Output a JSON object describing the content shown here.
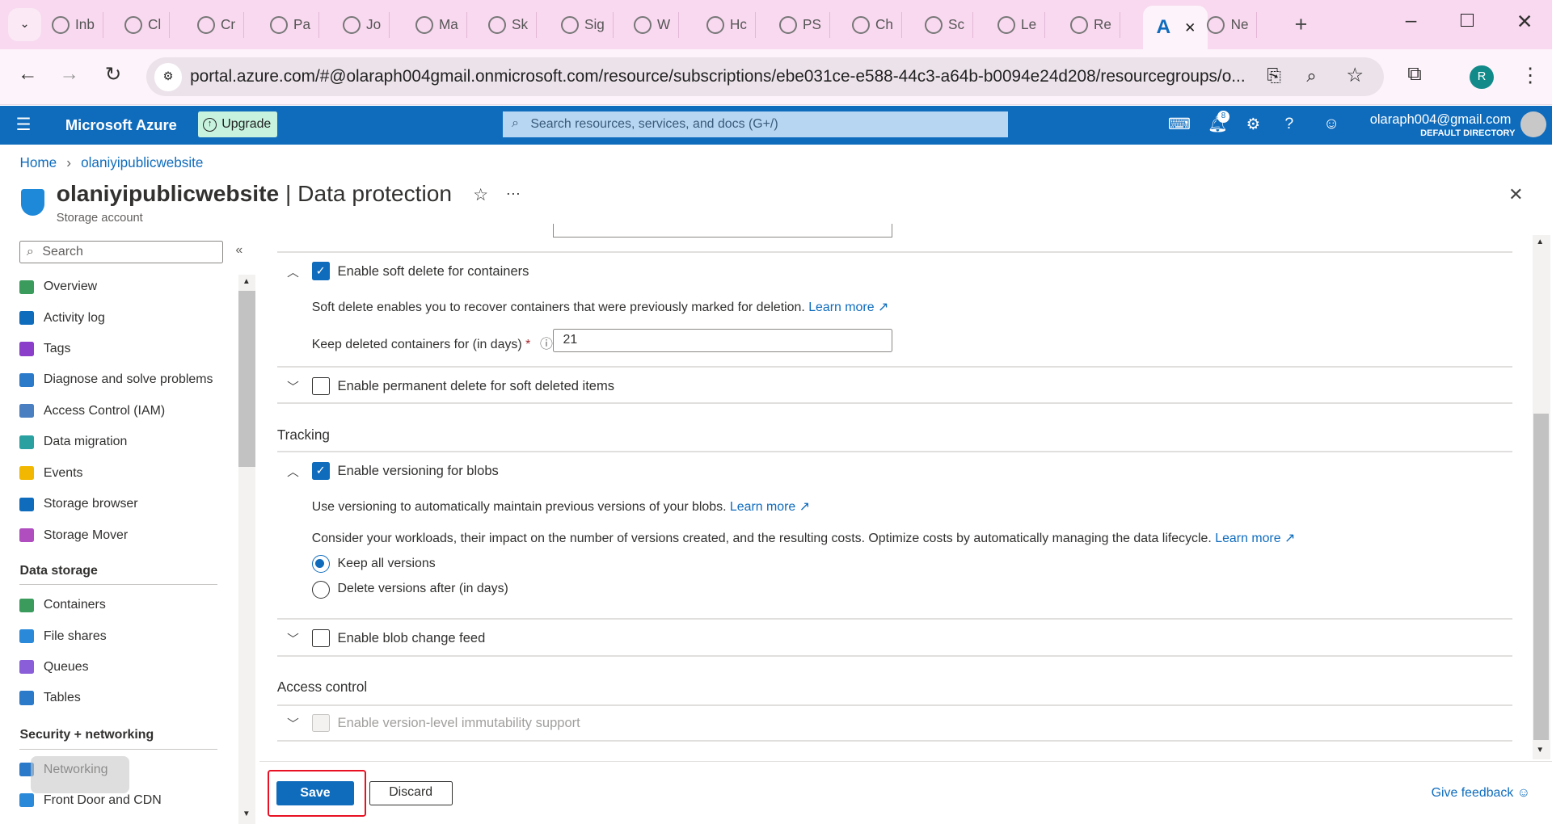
{
  "browser": {
    "tabs": [
      {
        "label": "Inb",
        "icon": "gmail-icon"
      },
      {
        "label": "Cl",
        "icon": "tc-icon"
      },
      {
        "label": "Cr",
        "icon": "dev-icon"
      },
      {
        "label": "Pa",
        "icon": "openai-icon"
      },
      {
        "label": "Jo",
        "icon": "openai-icon"
      },
      {
        "label": "Ma",
        "icon": "app-icon"
      },
      {
        "label": "Sk",
        "icon": "openai-icon"
      },
      {
        "label": "Sig",
        "icon": "chrome-icon"
      },
      {
        "label": "W",
        "icon": "microsoft-icon"
      },
      {
        "label": "Hc",
        "icon": "app-icon"
      },
      {
        "label": "PS",
        "icon": "openai-icon"
      },
      {
        "label": "Ch",
        "icon": "openai-icon"
      },
      {
        "label": "Sc",
        "icon": "check-icon"
      },
      {
        "label": "Le",
        "icon": "youtube-icon"
      },
      {
        "label": "Re",
        "icon": "google-icon"
      },
      {
        "label": "",
        "icon": "azure-icon",
        "active": true
      },
      {
        "label": "Ne",
        "icon": "chrome-icon"
      }
    ],
    "url": "portal.azure.com/#@olaraph004gmail.onmicrosoft.com/resource/subscriptions/ebe031ce-e588-44c3-a64b-b0094e24d208/resourcegroups/o...",
    "profile_initial": "R"
  },
  "header": {
    "brand": "Microsoft Azure",
    "upgrade": "Upgrade",
    "search_placeholder": "Search resources, services, and docs (G+/)",
    "notifications": "8",
    "user": "olaraph004@gmail.com",
    "directory": "DEFAULT DIRECTORY"
  },
  "breadcrumb": {
    "home": "Home",
    "resource": "olaniyipublicwebsite"
  },
  "page": {
    "title": "olaniyipublicwebsite",
    "section": "| Data protection",
    "subtitle": "Storage account"
  },
  "sidebar": {
    "search_placeholder": "Search",
    "items": [
      {
        "label": "Overview",
        "color": "#3a9b5c"
      },
      {
        "label": "Activity log",
        "color": "#0f6cbd"
      },
      {
        "label": "Tags",
        "color": "#8a3ec9"
      },
      {
        "label": "Diagnose and solve problems",
        "color": "#2a7ac9"
      },
      {
        "label": "Access Control (IAM)",
        "color": "#4a7fc1"
      },
      {
        "label": "Data migration",
        "color": "#2aa0a0"
      },
      {
        "label": "Events",
        "color": "#f2b700"
      },
      {
        "label": "Storage browser",
        "color": "#0f6cbd"
      },
      {
        "label": "Storage Mover",
        "color": "#b04ec0"
      }
    ],
    "groups": [
      {
        "title": "Data storage",
        "items": [
          {
            "label": "Containers",
            "color": "#3a9b5c"
          },
          {
            "label": "File shares",
            "color": "#2a8ad9"
          },
          {
            "label": "Queues",
            "color": "#8a5ed9"
          },
          {
            "label": "Tables",
            "color": "#2a7ac9"
          }
        ]
      },
      {
        "title": "Security + networking",
        "items": [
          {
            "label": "Networking",
            "color": "#2a7ac9"
          },
          {
            "label": "Front Door and CDN",
            "color": "#2a8ad9"
          }
        ]
      }
    ]
  },
  "content": {
    "soft_delete_containers": {
      "label": "Enable soft delete for containers",
      "checked": true,
      "desc": "Soft delete enables you to recover containers that were previously marked for deletion.",
      "learn": "Learn more",
      "field_label": "Keep deleted containers for (in days)",
      "required": "*",
      "value": "21"
    },
    "permanent_delete": {
      "label": "Enable permanent delete for soft deleted items",
      "checked": false
    },
    "tracking": {
      "title": "Tracking",
      "versioning": {
        "label": "Enable versioning for blobs",
        "checked": true,
        "desc": "Use versioning to automatically maintain previous versions of your blobs.",
        "learn": "Learn more",
        "desc2": "Consider your workloads, their impact on the number of versions created, and the resulting costs. Optimize costs by automatically managing the data lifecycle.",
        "learn2": "Learn more",
        "options": [
          "Keep all versions",
          "Delete versions after (in days)"
        ],
        "selected": "Keep all versions"
      },
      "change_feed": {
        "label": "Enable blob change feed",
        "checked": false
      }
    },
    "access_control": {
      "title": "Access control",
      "immutability": {
        "label": "Enable version-level immutability support",
        "checked": false,
        "disabled": true
      }
    }
  },
  "footer": {
    "save": "Save",
    "discard": "Discard",
    "feedback": "Give feedback"
  }
}
